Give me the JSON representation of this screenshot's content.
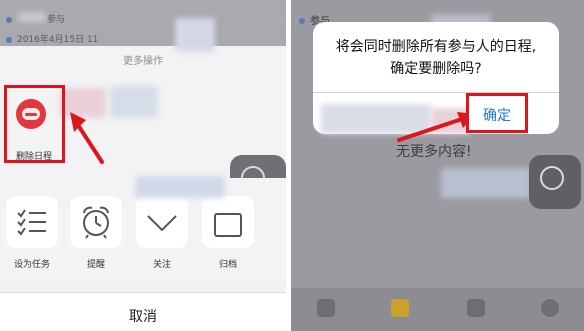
{
  "left": {
    "dimmed": {
      "participants": "参与",
      "date": "2016年4月15日 11"
    },
    "sheet_title": "更多操作",
    "actions": [
      {
        "label": "删除日程",
        "icon": "delete-circle-icon"
      },
      {
        "label": "设为任务",
        "icon": "checklist-icon"
      },
      {
        "label": "提醒",
        "icon": "alarm-clock-icon"
      },
      {
        "label": "关注",
        "icon": "chevron-down-icon"
      },
      {
        "label": "归档",
        "icon": "archive-box-icon"
      }
    ],
    "cancel": "取消"
  },
  "right": {
    "dimmed_top": "参与",
    "dialog": {
      "message": "将会同时删除所有参与人的日程,确定要删除吗?",
      "confirm": "确定"
    },
    "empty_text": "无更多内容!"
  },
  "colors": {
    "highlight": "#e0141b",
    "link_blue": "#1b7ae0",
    "delete_red": "#e2373c"
  }
}
